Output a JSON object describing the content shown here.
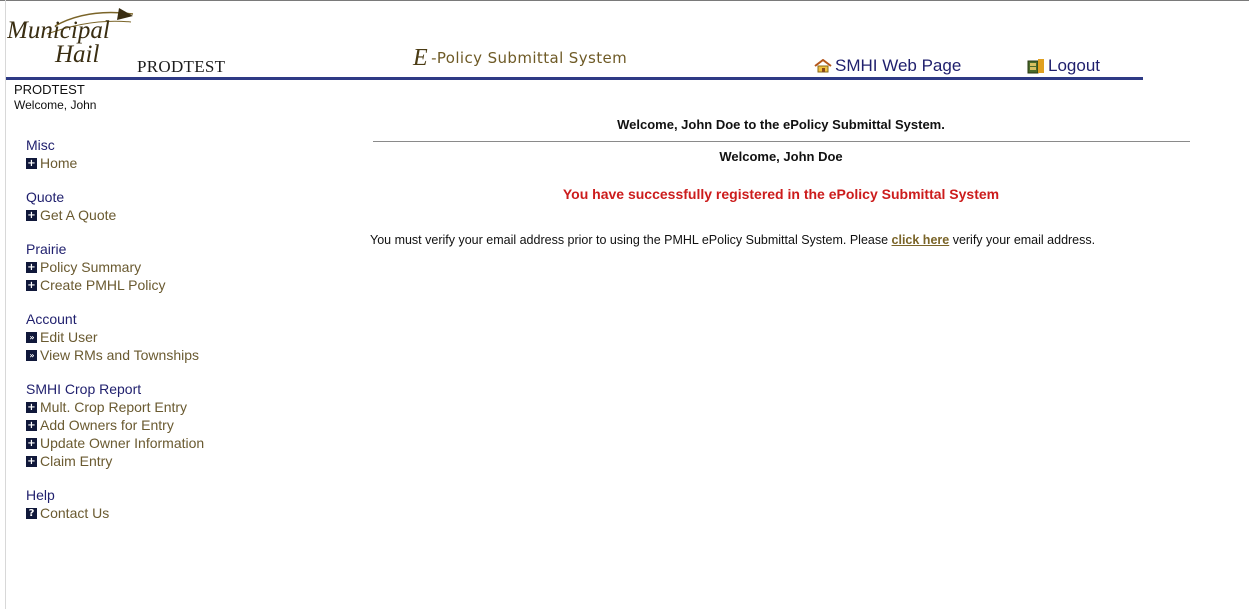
{
  "header": {
    "logo_text": "Municipal Hail",
    "environment": "PRODTEST",
    "system_title": {
      "e_letter": "E",
      "text": "-Policy Submittal System"
    },
    "web_page_link": "SMHI Web Page",
    "logout_link": "Logout"
  },
  "sidebar": {
    "environment": "PRODTEST",
    "welcome": "Welcome, John",
    "groups": [
      {
        "title": "Misc",
        "items": [
          {
            "label": "Home",
            "icon": "plus-icon"
          }
        ]
      },
      {
        "title": "Quote",
        "items": [
          {
            "label": "Get A Quote",
            "icon": "plus-icon"
          }
        ]
      },
      {
        "title": "Prairie",
        "items": [
          {
            "label": "Policy Summary",
            "icon": "plus-icon"
          },
          {
            "label": "Create PMHL Policy",
            "icon": "plus-icon"
          }
        ]
      },
      {
        "title": "Account",
        "items": [
          {
            "label": "Edit User",
            "icon": "double-arrow-icon"
          },
          {
            "label": "View RMs and Townships",
            "icon": "double-arrow-icon"
          }
        ]
      },
      {
        "title": "SMHI Crop Report",
        "items": [
          {
            "label": "Mult. Crop Report Entry",
            "icon": "plus-icon"
          },
          {
            "label": "Add Owners for Entry",
            "icon": "plus-icon"
          },
          {
            "label": "Update Owner Information",
            "icon": "plus-icon"
          },
          {
            "label": "Claim Entry",
            "icon": "plus-icon"
          }
        ]
      },
      {
        "title": "Help",
        "items": [
          {
            "label": "Contact Us",
            "icon": "question-icon"
          }
        ]
      }
    ]
  },
  "main": {
    "heading": "Welcome, John Doe to the ePolicy Submittal System.",
    "subheading": "Welcome, John Doe",
    "success_message": "You have successfully registered in the ePolicy Submittal System",
    "verify_before": "You must verify your email address prior to using the PMHL ePolicy Submittal System. Please ",
    "verify_link": "click here",
    "verify_after": " verify your email address."
  },
  "colors": {
    "nav_group": "#1f1f6d",
    "nav_item": "#6a5a30",
    "header_rule": "#2e3a85",
    "success": "#cc1c1c",
    "link": "#7a6428"
  }
}
